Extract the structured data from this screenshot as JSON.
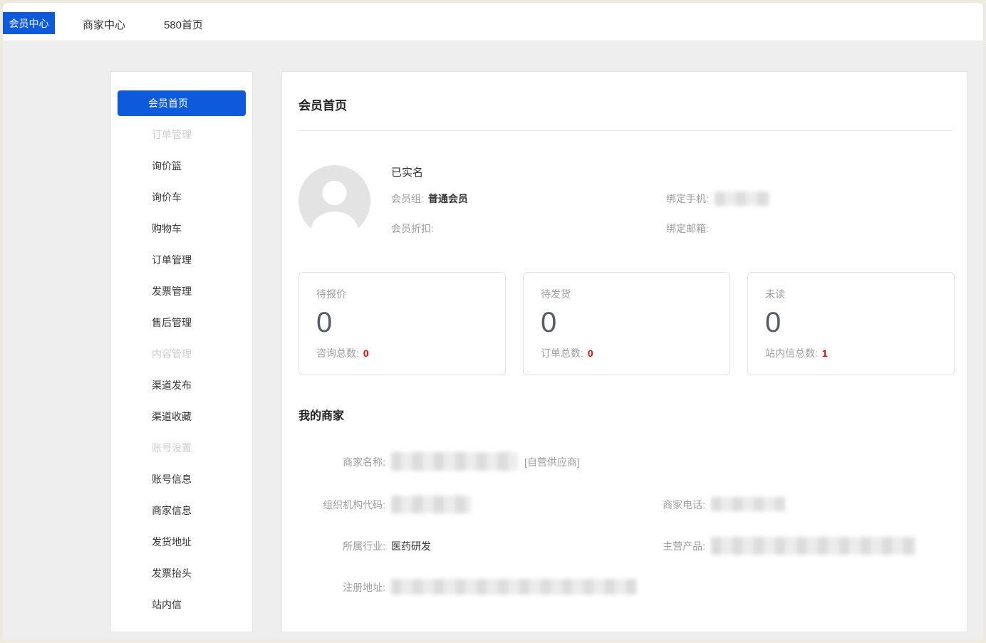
{
  "topnav": {
    "tabs": [
      {
        "label": "会员中心",
        "active": true
      },
      {
        "label": "商家中心",
        "active": false
      },
      {
        "label": "580首页",
        "active": false
      }
    ]
  },
  "sidebar": {
    "items": [
      {
        "label": "会员首页",
        "state": "active"
      },
      {
        "label": "订单管理",
        "state": "disabled"
      },
      {
        "label": "询价篮",
        "state": "normal"
      },
      {
        "label": "询价车",
        "state": "normal"
      },
      {
        "label": "购物车",
        "state": "normal"
      },
      {
        "label": "订单管理",
        "state": "normal"
      },
      {
        "label": "发票管理",
        "state": "normal"
      },
      {
        "label": "售后管理",
        "state": "normal"
      },
      {
        "label": "内容管理",
        "state": "disabled"
      },
      {
        "label": "渠道发布",
        "state": "normal"
      },
      {
        "label": "渠道收藏",
        "state": "normal"
      },
      {
        "label": "账号设置",
        "state": "disabled"
      },
      {
        "label": "账号信息",
        "state": "normal"
      },
      {
        "label": "商家信息",
        "state": "normal"
      },
      {
        "label": "发货地址",
        "state": "normal"
      },
      {
        "label": "发票抬头",
        "state": "normal"
      },
      {
        "label": "站内信",
        "state": "normal"
      }
    ]
  },
  "main": {
    "title": "会员首页",
    "profile": {
      "verified_badge": "已实名",
      "member_group_label": "会员组:",
      "member_group_value": "普通会员",
      "discount_label": "会员折扣:",
      "discount_value": "",
      "phone_label": "绑定手机:",
      "phone_redacted": true,
      "email_label": "绑定邮箱:",
      "email_value": ""
    },
    "stats": [
      {
        "title": "待报价",
        "count": "0",
        "footer_label": "咨询总数:",
        "footer_value": "0"
      },
      {
        "title": "待发货",
        "count": "0",
        "footer_label": "订单总数:",
        "footer_value": "0"
      },
      {
        "title": "未读",
        "count": "0",
        "footer_label": "站内信总数:",
        "footer_value": "1"
      }
    ],
    "merchant": {
      "title": "我的商家",
      "name_label": "商家名称:",
      "name_redacted": true,
      "name_suffix": "[自营供应商]",
      "org_code_label": "组织机构代码:",
      "org_code_redacted": true,
      "tel_label": "商家电话:",
      "tel_redacted": true,
      "industry_label": "所属行业:",
      "industry_value": "医药研发",
      "products_label": "主营产品:",
      "products_redacted": true,
      "address_label": "注册地址:",
      "address_redacted": true
    }
  },
  "colors": {
    "accent_blue": "#0d5bdc",
    "count_red": "#f00000",
    "page_background": "#eeeeee",
    "frame_beige": "#eeeade"
  }
}
